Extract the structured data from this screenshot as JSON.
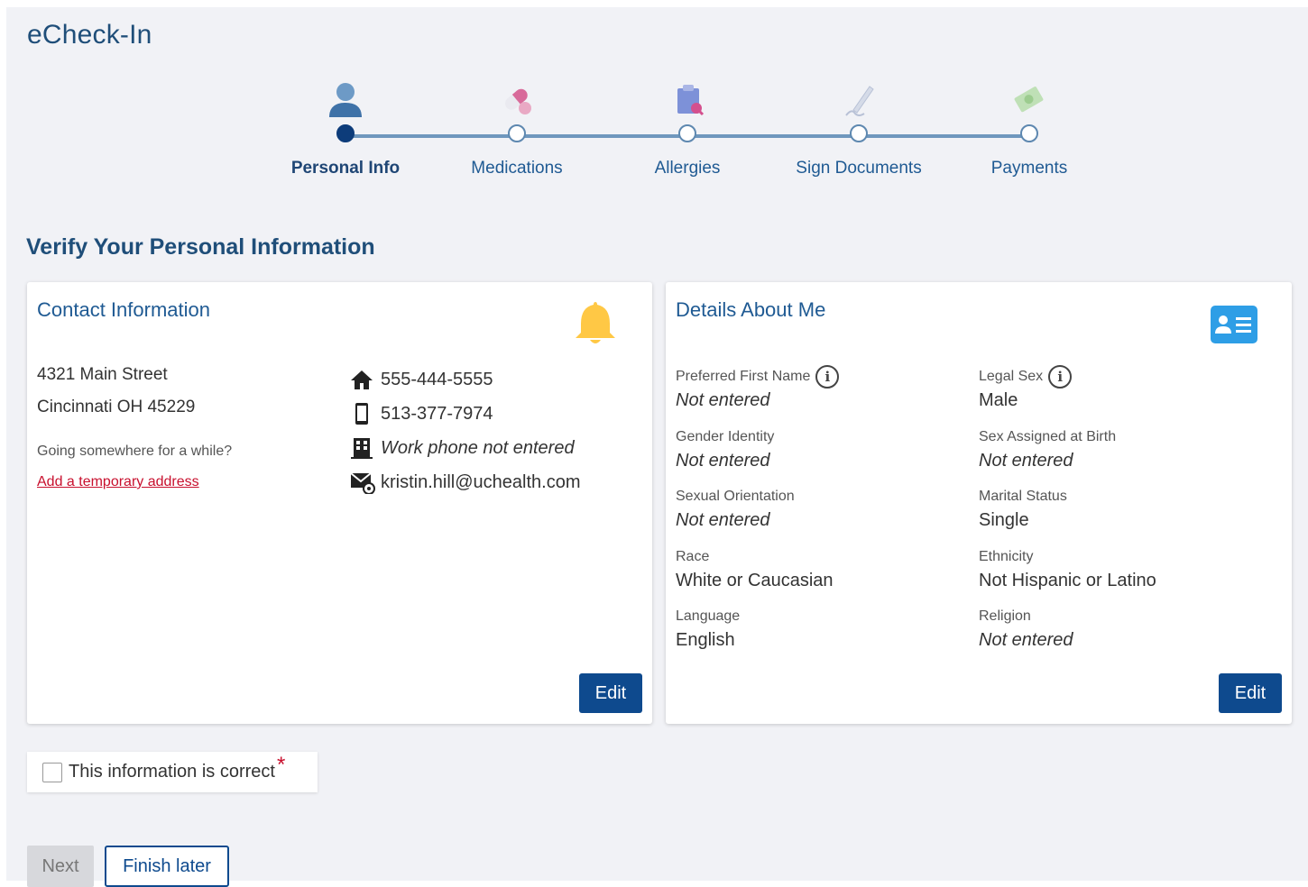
{
  "app": {
    "title": "eCheck-In"
  },
  "stepper": {
    "steps": [
      {
        "label": "Personal Info",
        "icon": "person-icon",
        "state": "active"
      },
      {
        "label": "Medications",
        "icon": "pill-icon",
        "state": "pending"
      },
      {
        "label": "Allergies",
        "icon": "allergy-clipboard-icon",
        "state": "pending"
      },
      {
        "label": "Sign Documents",
        "icon": "pen-signature-icon",
        "state": "pending"
      },
      {
        "label": "Payments",
        "icon": "money-icon",
        "state": "pending"
      }
    ]
  },
  "section": {
    "title": "Verify Your Personal Information"
  },
  "contact": {
    "title": "Contact Information",
    "icon": "bell-icon",
    "address_line1": "4321 Main Street",
    "address_line2": "Cincinnati OH 45229",
    "temp_prompt": "Going somewhere for a while?",
    "temp_link": "Add a temporary address",
    "home_phone": "555-444-5555",
    "mobile_phone": "513-377-7974",
    "work_phone": "Work phone not entered",
    "email": "kristin.hill@uchealth.com",
    "edit_label": "Edit"
  },
  "details": {
    "title": "Details About Me",
    "icon": "id-card-icon",
    "fields": [
      {
        "label": "Preferred First Name",
        "value": "Not entered",
        "info": true
      },
      {
        "label": "Legal Sex",
        "value": "Male",
        "info": true
      },
      {
        "label": "Gender Identity",
        "value": "Not entered"
      },
      {
        "label": "Sex Assigned at Birth",
        "value": "Not entered"
      },
      {
        "label": "Sexual Orientation",
        "value": "Not entered"
      },
      {
        "label": "Marital Status",
        "value": "Single"
      },
      {
        "label": "Race",
        "value": "White or Caucasian"
      },
      {
        "label": "Ethnicity",
        "value": "Not Hispanic or Latino"
      },
      {
        "label": "Language",
        "value": "English"
      },
      {
        "label": "Religion",
        "value": "Not entered"
      }
    ],
    "edit_label": "Edit"
  },
  "confirm": {
    "label": "This information is correct",
    "required_mark": "*",
    "checked": false
  },
  "footer": {
    "next_label": "Next",
    "finish_later_label": "Finish later"
  },
  "colors": {
    "primary": "#0e4a8e",
    "heading": "#1f4e79",
    "link_red": "#c8102e",
    "background": "#f1f2f6"
  }
}
